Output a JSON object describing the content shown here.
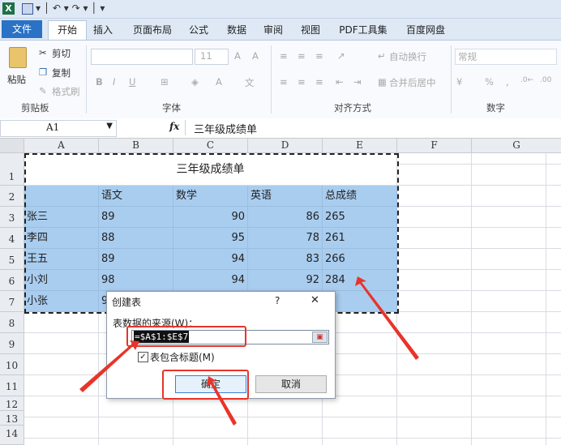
{
  "titlebar": {
    "quick_access": "▾ │ ↶ ▾ ↷ ▾ │ ▾"
  },
  "tabs": [
    "文件",
    "开始",
    "插入",
    "页面布局",
    "公式",
    "数据",
    "审阅",
    "视图",
    "PDF工具集",
    "百度网盘"
  ],
  "ribbon": {
    "clipboard": {
      "paste": "粘贴",
      "cut": "剪切",
      "copy": "复制",
      "format_painter": "格式刷",
      "group": "剪贴板"
    },
    "font": {
      "size": "11",
      "bold": "B",
      "italic": "I",
      "underline": "U",
      "group": "字体"
    },
    "alignment": {
      "wrap": "自动换行",
      "merge": "合并后居中",
      "group": "对齐方式"
    },
    "number": {
      "format": "常规",
      "percent": "%",
      "comma": ",",
      "group": "数字"
    }
  },
  "formula_bar": {
    "name_box": "A1",
    "fx": "fx",
    "content": "三年级成绩单"
  },
  "columns": [
    "A",
    "B",
    "C",
    "D",
    "E",
    "F",
    "G"
  ],
  "rows": [
    "1",
    "2",
    "3",
    "4",
    "5",
    "6",
    "7",
    "8",
    "9",
    "10",
    "11",
    "12",
    "13",
    "14"
  ],
  "sheet": {
    "title": "三年级成绩单",
    "headers": [
      "",
      "语文",
      "数学",
      "英语",
      "总成绩"
    ],
    "data": [
      [
        "张三",
        "89",
        "90",
        "86",
        "265"
      ],
      [
        "李四",
        "88",
        "95",
        "78",
        "261"
      ],
      [
        "王五",
        "89",
        "94",
        "83",
        "266"
      ],
      [
        "小刘",
        "98",
        "94",
        "92",
        "284"
      ],
      [
        "小张",
        "9",
        "",
        "",
        "3"
      ]
    ]
  },
  "dialog": {
    "title": "创建表",
    "help": "?",
    "close": "✕",
    "source_label": "表数据的来源(W)：",
    "source_value": "=$A$1:$E$7",
    "has_headers": "表包含标题(M)",
    "ok": "确定",
    "cancel": "取消"
  },
  "colors": {
    "selection": "#a9cdef",
    "annotation": "#e8342a",
    "file_tab": "#2a72c6"
  }
}
